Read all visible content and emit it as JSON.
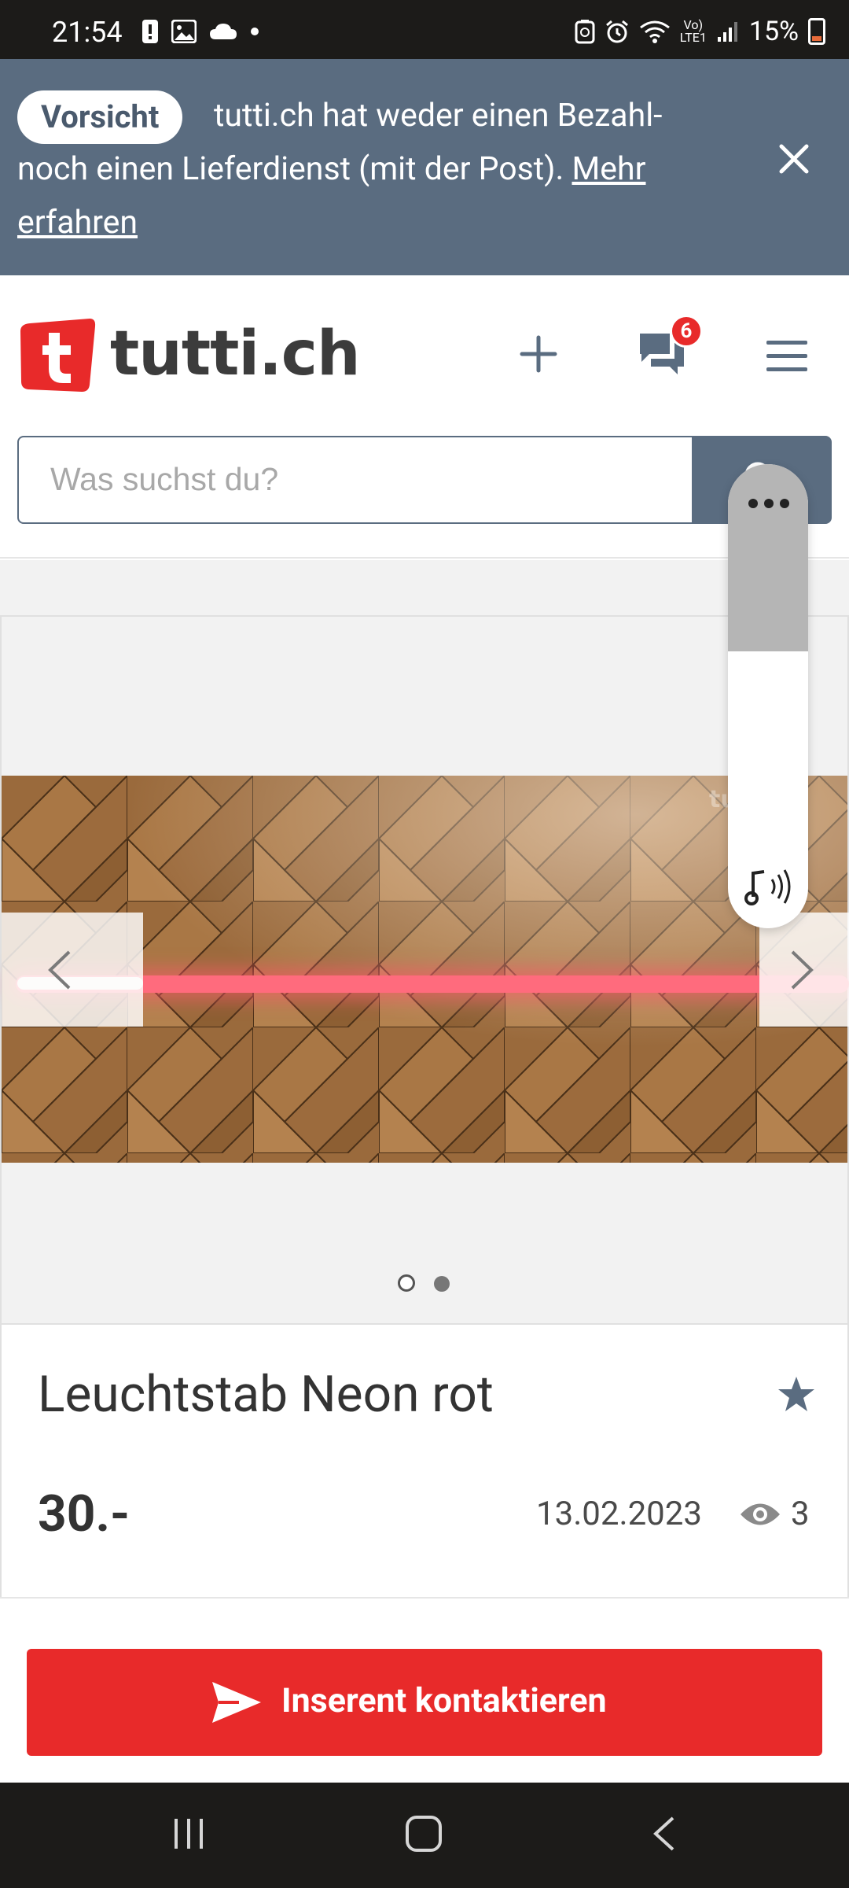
{
  "status_bar": {
    "time": "21:54",
    "battery": "15%",
    "network": "LTE1"
  },
  "banner": {
    "badge": "Vorsicht",
    "text": "tutti.ch hat weder einen Bezahl- noch einen Lieferdienst (mit der Post).",
    "link": "Mehr erfahren",
    "close_icon": "close-icon"
  },
  "header": {
    "logo_text": "tutti.ch",
    "logo_letter": "t",
    "message_count": "6",
    "icons": [
      "plus-icon",
      "chat-icon",
      "menu-icon"
    ]
  },
  "search": {
    "placeholder": "Was suchst du?"
  },
  "gallery": {
    "total_images": 2,
    "active_index": 2,
    "watermark": "tutti.ch"
  },
  "listing": {
    "title": "Leuchtstab Neon rot",
    "price": "30.-",
    "date": "13.02.2023",
    "views": "3"
  },
  "contact": {
    "label": "Inserent kontaktieren"
  },
  "colors": {
    "brand_red": "#e82a2a",
    "slate": "#5a6c80",
    "text_dark": "#333333"
  }
}
